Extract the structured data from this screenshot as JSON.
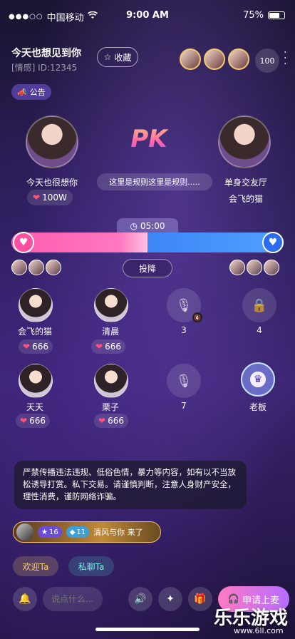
{
  "status": {
    "carrier": "中国移动",
    "time": "9:00 AM",
    "battery": "75%"
  },
  "room": {
    "title": "今天也想见到你",
    "subtitle": "[情感] ID:12345",
    "collect_label": "收藏",
    "viewer_count": "100"
  },
  "notice_label": "公告",
  "pk": {
    "left_name": "今天也很想你",
    "left_score": "100W",
    "right_room": "单身交友厅",
    "right_owner": "会飞的猫",
    "logo": "PK",
    "rule_text": "这里是规则这里是规则.....",
    "timer": "05:00",
    "progress_left_fraction": 0.5,
    "surrender_label": "投降"
  },
  "seats": [
    {
      "name": "会飞的猫",
      "score": "666"
    },
    {
      "name": "清晨",
      "score": "666"
    },
    {
      "name": "3"
    },
    {
      "name": "4"
    },
    {
      "name": "天天",
      "score": "666"
    },
    {
      "name": "栗子",
      "score": "666"
    },
    {
      "name": "7"
    },
    {
      "name": "老板"
    }
  ],
  "warning_text": "严禁传播违法违规、低俗色情，暴力等内容，如有以不当放松诱导打赏。私下交易。请谨慎判断，注意人身财产安全，理性消费，谨防网络诈骗。",
  "join": {
    "level1": "16",
    "level2": "11",
    "message": "清风与你 来了"
  },
  "actions": {
    "welcome": "欢迎Ta",
    "dm": "私聊Ta"
  },
  "bottom": {
    "input_placeholder": "说点什么...",
    "apply_label": "申请上麦"
  },
  "watermark": {
    "title": "乐乐游戏",
    "url": "www.6ll.com"
  },
  "colors": {
    "pink": "#ff5bb0",
    "blue": "#2a6cf0",
    "gold": "#f1c16a"
  }
}
